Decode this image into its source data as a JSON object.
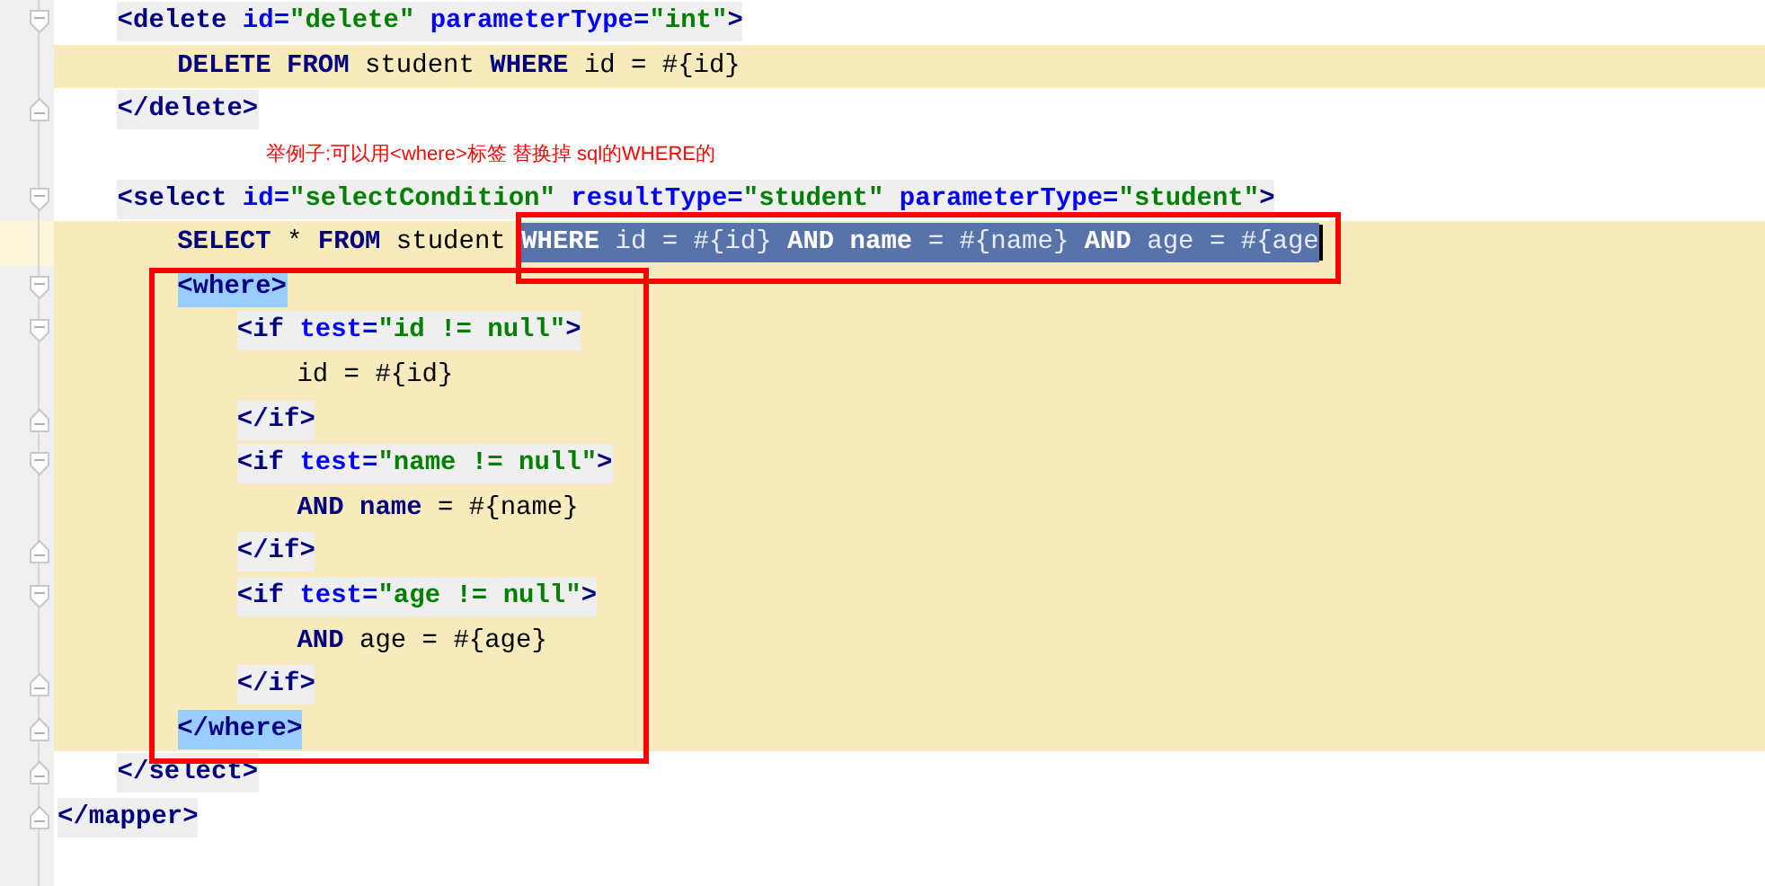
{
  "code": {
    "lines": [
      {
        "kind": "open_tag",
        "highlighted": false,
        "tokens": [
          {
            "kind": "tag",
            "text": "<delete"
          },
          {
            "kind": "attr",
            "text": " id="
          },
          {
            "kind": "value",
            "text": "\"delete\""
          },
          {
            "kind": "attr",
            "text": " parameterType="
          },
          {
            "kind": "value",
            "text": "\"int\""
          },
          {
            "kind": "tag",
            "text": ">"
          }
        ],
        "children": [
          {
            "kind": "body",
            "highlighted": true,
            "tokens": [
              {
                "kind": "keyword",
                "text": "DELETE"
              },
              {
                "kind": "keyword",
                "text": " FROM"
              },
              {
                "kind": "text",
                "text": " student "
              },
              {
                "kind": "keyword",
                "text": "WHERE"
              },
              {
                "kind": "text",
                "text": " id = #{id}"
              }
            ]
          }
        ]
      },
      {
        "kind": "close_tag",
        "highlighted": false,
        "tokens": [
          {
            "kind": "tag",
            "text": "</delete>"
          }
        ]
      },
      {
        "kind": "note",
        "text": "举例子:可以用<where>标签 替换掉 sql的WHERE的"
      },
      {
        "kind": "open_tag",
        "highlighted": false,
        "tokens": [
          {
            "kind": "tag",
            "text": "<select"
          },
          {
            "kind": "attr",
            "text": " id="
          },
          {
            "kind": "value",
            "text": "\"selectCondition\""
          },
          {
            "kind": "attr",
            "text": " resultType="
          },
          {
            "kind": "value",
            "text": "\"student\""
          },
          {
            "kind": "attr",
            "text": " parameterType="
          },
          {
            "kind": "value",
            "text": "\"student\""
          },
          {
            "kind": "tag",
            "text": ">"
          }
        ],
        "children": [
          {
            "kind": "body",
            "highlighted": true,
            "current": true,
            "tokens": [
              {
                "kind": "keyword",
                "text": "SELECT"
              },
              {
                "kind": "text",
                "text": " * "
              },
              {
                "kind": "keyword",
                "text": "FROM"
              },
              {
                "kind": "text",
                "text": " student "
              }
            ],
            "selection": [
              {
                "kind": "keyword",
                "text": "WHERE"
              },
              {
                "kind": "text",
                "text": " id = #{id} "
              },
              {
                "kind": "keyword",
                "text": "AND"
              },
              {
                "kind": "keyword",
                "text": " name"
              },
              {
                "kind": "text",
                "text": " = #{name} "
              },
              {
                "kind": "keyword",
                "text": "AND"
              },
              {
                "kind": "text",
                "text": " age = #{age"
              }
            ]
          },
          {
            "kind": "open_tag",
            "highlighted": true,
            "matched": true,
            "tokens": [
              {
                "kind": "tag",
                "text": "<where>"
              }
            ],
            "children": [
              {
                "kind": "open_tag",
                "highlighted": true,
                "matched": false,
                "tokens": [
                  {
                    "kind": "tag",
                    "text": "<if"
                  },
                  {
                    "kind": "attr",
                    "text": " test="
                  },
                  {
                    "kind": "value",
                    "text": "\"id != null\""
                  },
                  {
                    "kind": "tag",
                    "text": ">"
                  }
                ],
                "children": [
                  {
                    "kind": "body",
                    "highlighted": true,
                    "tokens": [
                      {
                        "kind": "text",
                        "text": "id = #{id}"
                      }
                    ]
                  }
                ]
              },
              {
                "kind": "close_tag",
                "highlighted": true,
                "matched": false,
                "tokens": [
                  {
                    "kind": "tag",
                    "text": "</if>"
                  }
                ]
              },
              {
                "kind": "open_tag",
                "highlighted": true,
                "matched": false,
                "tokens": [
                  {
                    "kind": "tag",
                    "text": "<if"
                  },
                  {
                    "kind": "attr",
                    "text": " test="
                  },
                  {
                    "kind": "value",
                    "text": "\"name != null\""
                  },
                  {
                    "kind": "tag",
                    "text": ">"
                  }
                ],
                "children": [
                  {
                    "kind": "body",
                    "highlighted": true,
                    "tokens": [
                      {
                        "kind": "keyword",
                        "text": "AND"
                      },
                      {
                        "kind": "keyword",
                        "text": " name"
                      },
                      {
                        "kind": "text",
                        "text": " = #{name}"
                      }
                    ]
                  }
                ]
              },
              {
                "kind": "close_tag",
                "highlighted": true,
                "matched": false,
                "tokens": [
                  {
                    "kind": "tag",
                    "text": "</if>"
                  }
                ]
              },
              {
                "kind": "open_tag",
                "highlighted": true,
                "matched": false,
                "tokens": [
                  {
                    "kind": "tag",
                    "text": "<if"
                  },
                  {
                    "kind": "attr",
                    "text": " test="
                  },
                  {
                    "kind": "value",
                    "text": "\"age != null\""
                  },
                  {
                    "kind": "tag",
                    "text": ">"
                  }
                ],
                "children": [
                  {
                    "kind": "body",
                    "highlighted": true,
                    "tokens": [
                      {
                        "kind": "keyword",
                        "text": "AND"
                      },
                      {
                        "kind": "text",
                        "text": " age = #{age}"
                      }
                    ]
                  }
                ]
              },
              {
                "kind": "close_tag",
                "highlighted": true,
                "matched": false,
                "tokens": [
                  {
                    "kind": "tag",
                    "text": "</if>"
                  }
                ]
              }
            ]
          },
          {
            "kind": "close_tag",
            "highlighted": true,
            "matched": true,
            "tokens": [
              {
                "kind": "tag",
                "text": "</where>"
              }
            ]
          }
        ]
      },
      {
        "kind": "close_tag",
        "highlighted": false,
        "tokens": [
          {
            "kind": "tag",
            "text": "</select>"
          }
        ]
      }
    ],
    "closing": {
      "kind": "close_tag",
      "highlighted": false,
      "tokens": [
        {
          "kind": "tag",
          "text": "</mapper>"
        }
      ]
    }
  }
}
